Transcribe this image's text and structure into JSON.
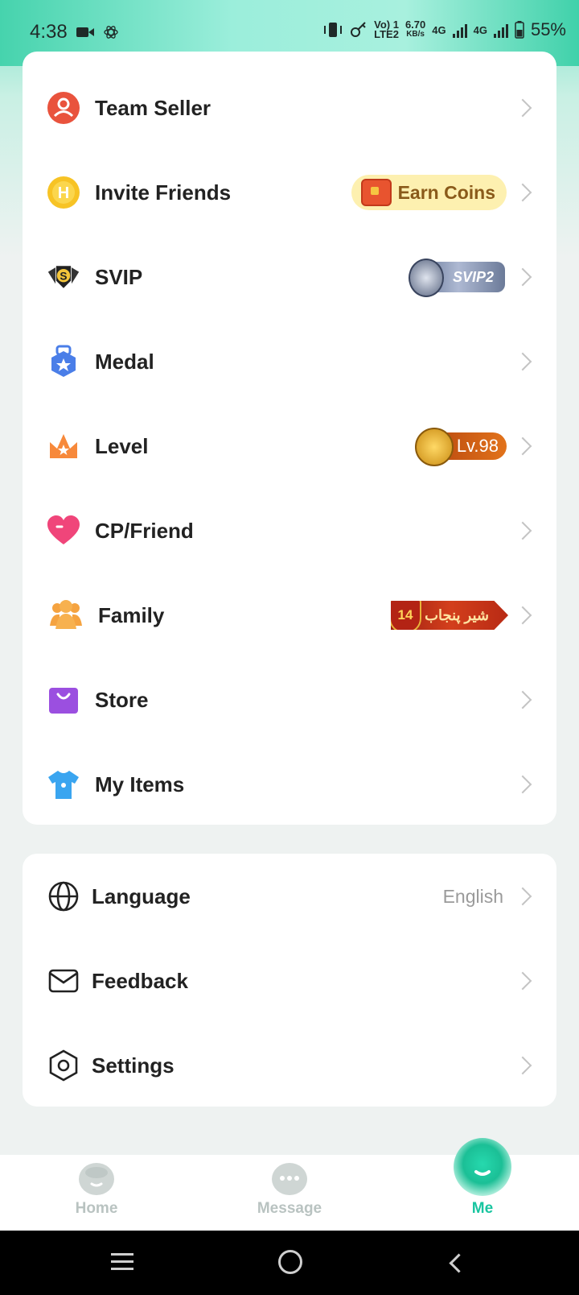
{
  "status_bar": {
    "time": "4:38",
    "network_label": "LTE2",
    "volte_label": "Vo) 1",
    "speed_value": "6.70",
    "speed_unit": "KB/s",
    "sim1": "4G",
    "sim2": "4G",
    "battery": "55%"
  },
  "menu": {
    "items": [
      {
        "label": "Team Seller",
        "icon": "team-seller-icon"
      },
      {
        "label": "Invite Friends",
        "icon": "invite-coin-icon",
        "badge": "Earn Coins"
      },
      {
        "label": "SVIP",
        "icon": "svip-shield-icon",
        "badge": "SVIP2"
      },
      {
        "label": "Medal",
        "icon": "medal-icon"
      },
      {
        "label": "Level",
        "icon": "crown-icon",
        "badge": "Lv.98"
      },
      {
        "label": "CP/Friend",
        "icon": "heart-icon"
      },
      {
        "label": "Family",
        "icon": "family-icon",
        "badge": "شیر پنجاب",
        "badge_number": "14"
      },
      {
        "label": "Store",
        "icon": "store-bag-icon"
      },
      {
        "label": "My Items",
        "icon": "shirt-icon"
      }
    ]
  },
  "settings_menu": {
    "items": [
      {
        "label": "Language",
        "icon": "globe-icon",
        "value": "English"
      },
      {
        "label": "Feedback",
        "icon": "mail-icon"
      },
      {
        "label": "Settings",
        "icon": "settings-icon"
      }
    ]
  },
  "tabbar": {
    "tabs": [
      {
        "label": "Home",
        "icon": "home-icon",
        "active": false
      },
      {
        "label": "Message",
        "icon": "message-icon",
        "active": false
      },
      {
        "label": "Me",
        "icon": "me-icon",
        "active": true
      }
    ]
  },
  "colors": {
    "accent": "#19c5a0",
    "text": "#222222",
    "muted": "#9a9a9a"
  }
}
